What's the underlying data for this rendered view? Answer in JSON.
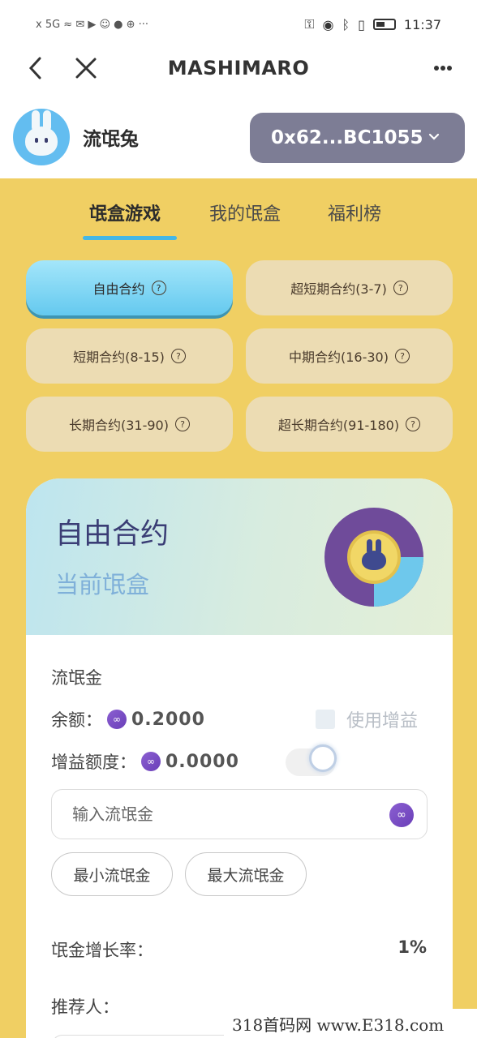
{
  "status_bar": {
    "left_icons": "x 5G ≈ ✉ ▶ ☺ ● ⊕ ···",
    "time": "11:37"
  },
  "nav": {
    "title": "MASHIMARO",
    "back_icon": "chevron-left",
    "close_icon": "close",
    "more_icon": "more-horizontal"
  },
  "user": {
    "name": "流氓兔",
    "wallet": "0x62...BC1055"
  },
  "tabs": [
    {
      "label": "氓盒游戏",
      "active": true
    },
    {
      "label": "我的氓盒",
      "active": false
    },
    {
      "label": "福利榜",
      "active": false
    }
  ],
  "contracts": [
    {
      "label": "自由合约",
      "active": true
    },
    {
      "label": "超短期合约(3-7)",
      "active": false
    },
    {
      "label": "短期合约(8-15)",
      "active": false
    },
    {
      "label": "中期合约(16-30)",
      "active": false
    },
    {
      "label": "长期合约(31-90)",
      "active": false
    },
    {
      "label": "超长期合约(91-180)",
      "active": false
    }
  ],
  "card": {
    "title": "自由合约",
    "subtitle": "当前氓盒",
    "section_label": "流氓金",
    "balance_label": "余额：",
    "balance_value": "0.2000",
    "use_boost_label": "使用增益",
    "gain_label": "增益额度：",
    "gain_value": "0.0000",
    "input_placeholder": "输入流氓金",
    "min_button": "最小流氓金",
    "max_button": "最大流氓金",
    "growth_label": "氓金增长率：",
    "growth_value": "1%",
    "referrer_label": "推荐人："
  },
  "watermark": "318首码网 www.E318.com",
  "colors": {
    "page_bg": "#f0cf63",
    "active_chip": "#64c9ef",
    "chip": "#ecdcb3",
    "wallet": "#7d7d95",
    "accent": "#45b7e6"
  }
}
